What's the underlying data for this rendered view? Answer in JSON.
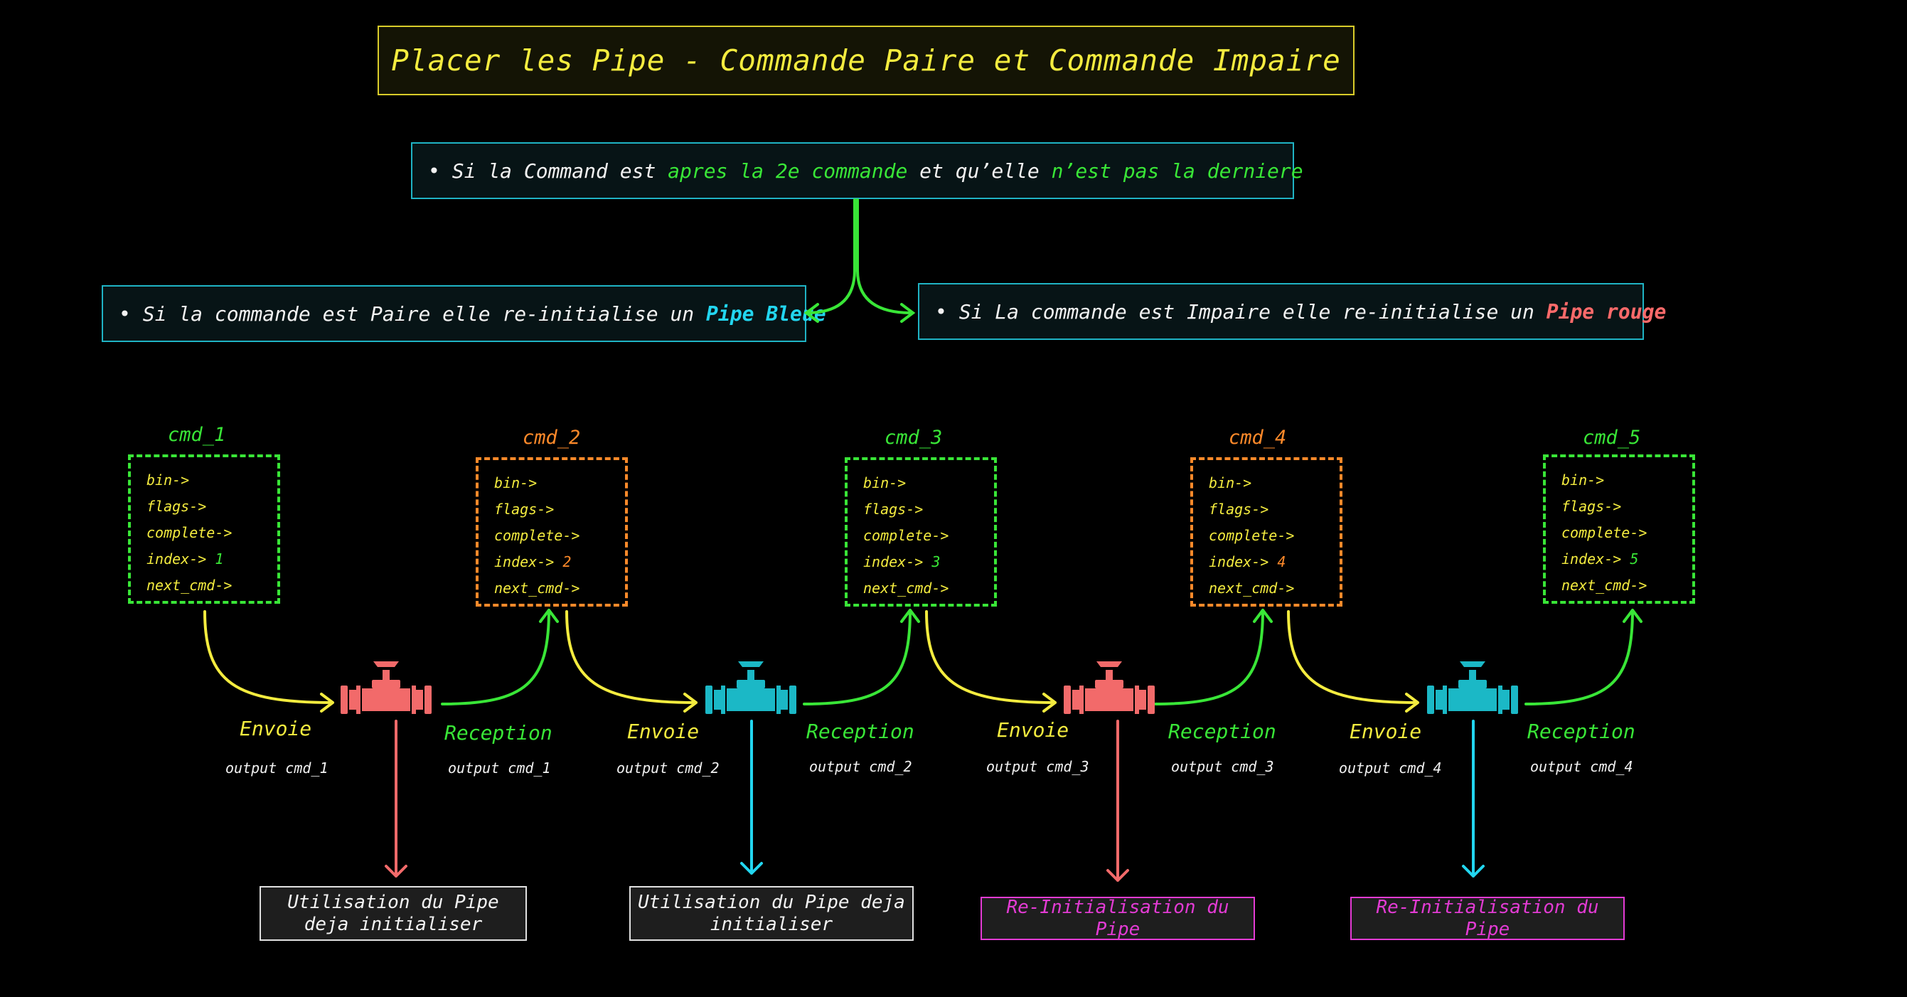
{
  "title": "Placer les Pipe - Commande Paire et Commande Impaire",
  "rule_top": {
    "bullet": "•",
    "t1": "Si la Command est",
    "t2": "apres la 2e commande",
    "t3": "et qu’elle",
    "t4": "n’est pas la derniere"
  },
  "rule_left": {
    "bullet": "•",
    "t1": "Si la commande est Paire elle re-initialise un",
    "t2": "Pipe Bleue"
  },
  "rule_right": {
    "bullet": "•",
    "t1": "Si La commande est Impaire elle re-initialise un",
    "t2": "Pipe rouge"
  },
  "commands": [
    {
      "name": "cmd_1",
      "bin": "bin->",
      "flags": "flags->",
      "complete": "complete->",
      "index_label": "index->",
      "index": "1",
      "next": "next_cmd->"
    },
    {
      "name": "cmd_2",
      "bin": "bin->",
      "flags": "flags->",
      "complete": "complete->",
      "index_label": "index->",
      "index": "2",
      "next": "next_cmd->"
    },
    {
      "name": "cmd_3",
      "bin": "bin->",
      "flags": "flags->",
      "complete": "complete->",
      "index_label": "index->",
      "index": "3",
      "next": "next_cmd->"
    },
    {
      "name": "cmd_4",
      "bin": "bin->",
      "flags": "flags->",
      "complete": "complete->",
      "index_label": "index->",
      "index": "4",
      "next": "next_cmd->"
    },
    {
      "name": "cmd_5",
      "bin": "bin->",
      "flags": "flags->",
      "complete": "complete->",
      "index_label": "index->",
      "index": "5",
      "next": "next_cmd->"
    }
  ],
  "stages": [
    {
      "send": "Envoie",
      "send_out": "output cmd_1",
      "recv": "Reception",
      "recv_out": "output cmd_1",
      "result": "Utilisation du Pipe deja initialiser"
    },
    {
      "send": "Envoie",
      "send_out": "output cmd_2",
      "recv": "Reception",
      "recv_out": "output cmd_2",
      "result": "Utilisation du Pipe deja initialiser"
    },
    {
      "send": "Envoie",
      "send_out": "output cmd_3",
      "recv": "Reception",
      "recv_out": "output cmd_3",
      "result": "Re-Initialisation du Pipe"
    },
    {
      "send": "Envoie",
      "send_out": "output cmd_4",
      "recv": "Reception",
      "recv_out": "output cmd_4",
      "result": "Re-Initialisation du Pipe"
    }
  ],
  "colors": {
    "green": "#39e637",
    "orange": "#ff8a2a",
    "yellow": "#f4ec3f",
    "red_pipe": "#f26a6a",
    "cyan_pipe": "#1bb8c6",
    "magenta": "#e33bd4",
    "white": "#f2f2f2"
  }
}
